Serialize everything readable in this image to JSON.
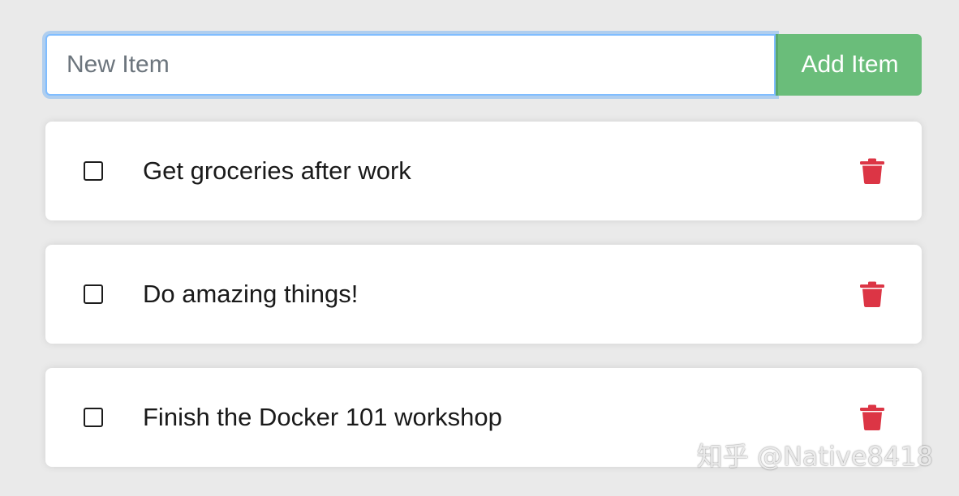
{
  "form": {
    "input_value": "",
    "input_placeholder": "New Item",
    "add_label": "Add Item"
  },
  "items": [
    {
      "name": "Get groceries after work",
      "completed": false
    },
    {
      "name": "Do amazing things!",
      "completed": false
    },
    {
      "name": "Finish the Docker 101 workshop",
      "completed": false
    }
  ],
  "icons": {
    "checkbox": "checkbox-icon",
    "delete": "trash-icon"
  },
  "colors": {
    "add_button": "#6abd7a",
    "trash": "#dc3545",
    "input_focus": "#80bdff"
  },
  "watermark": "知乎 @Native8418"
}
